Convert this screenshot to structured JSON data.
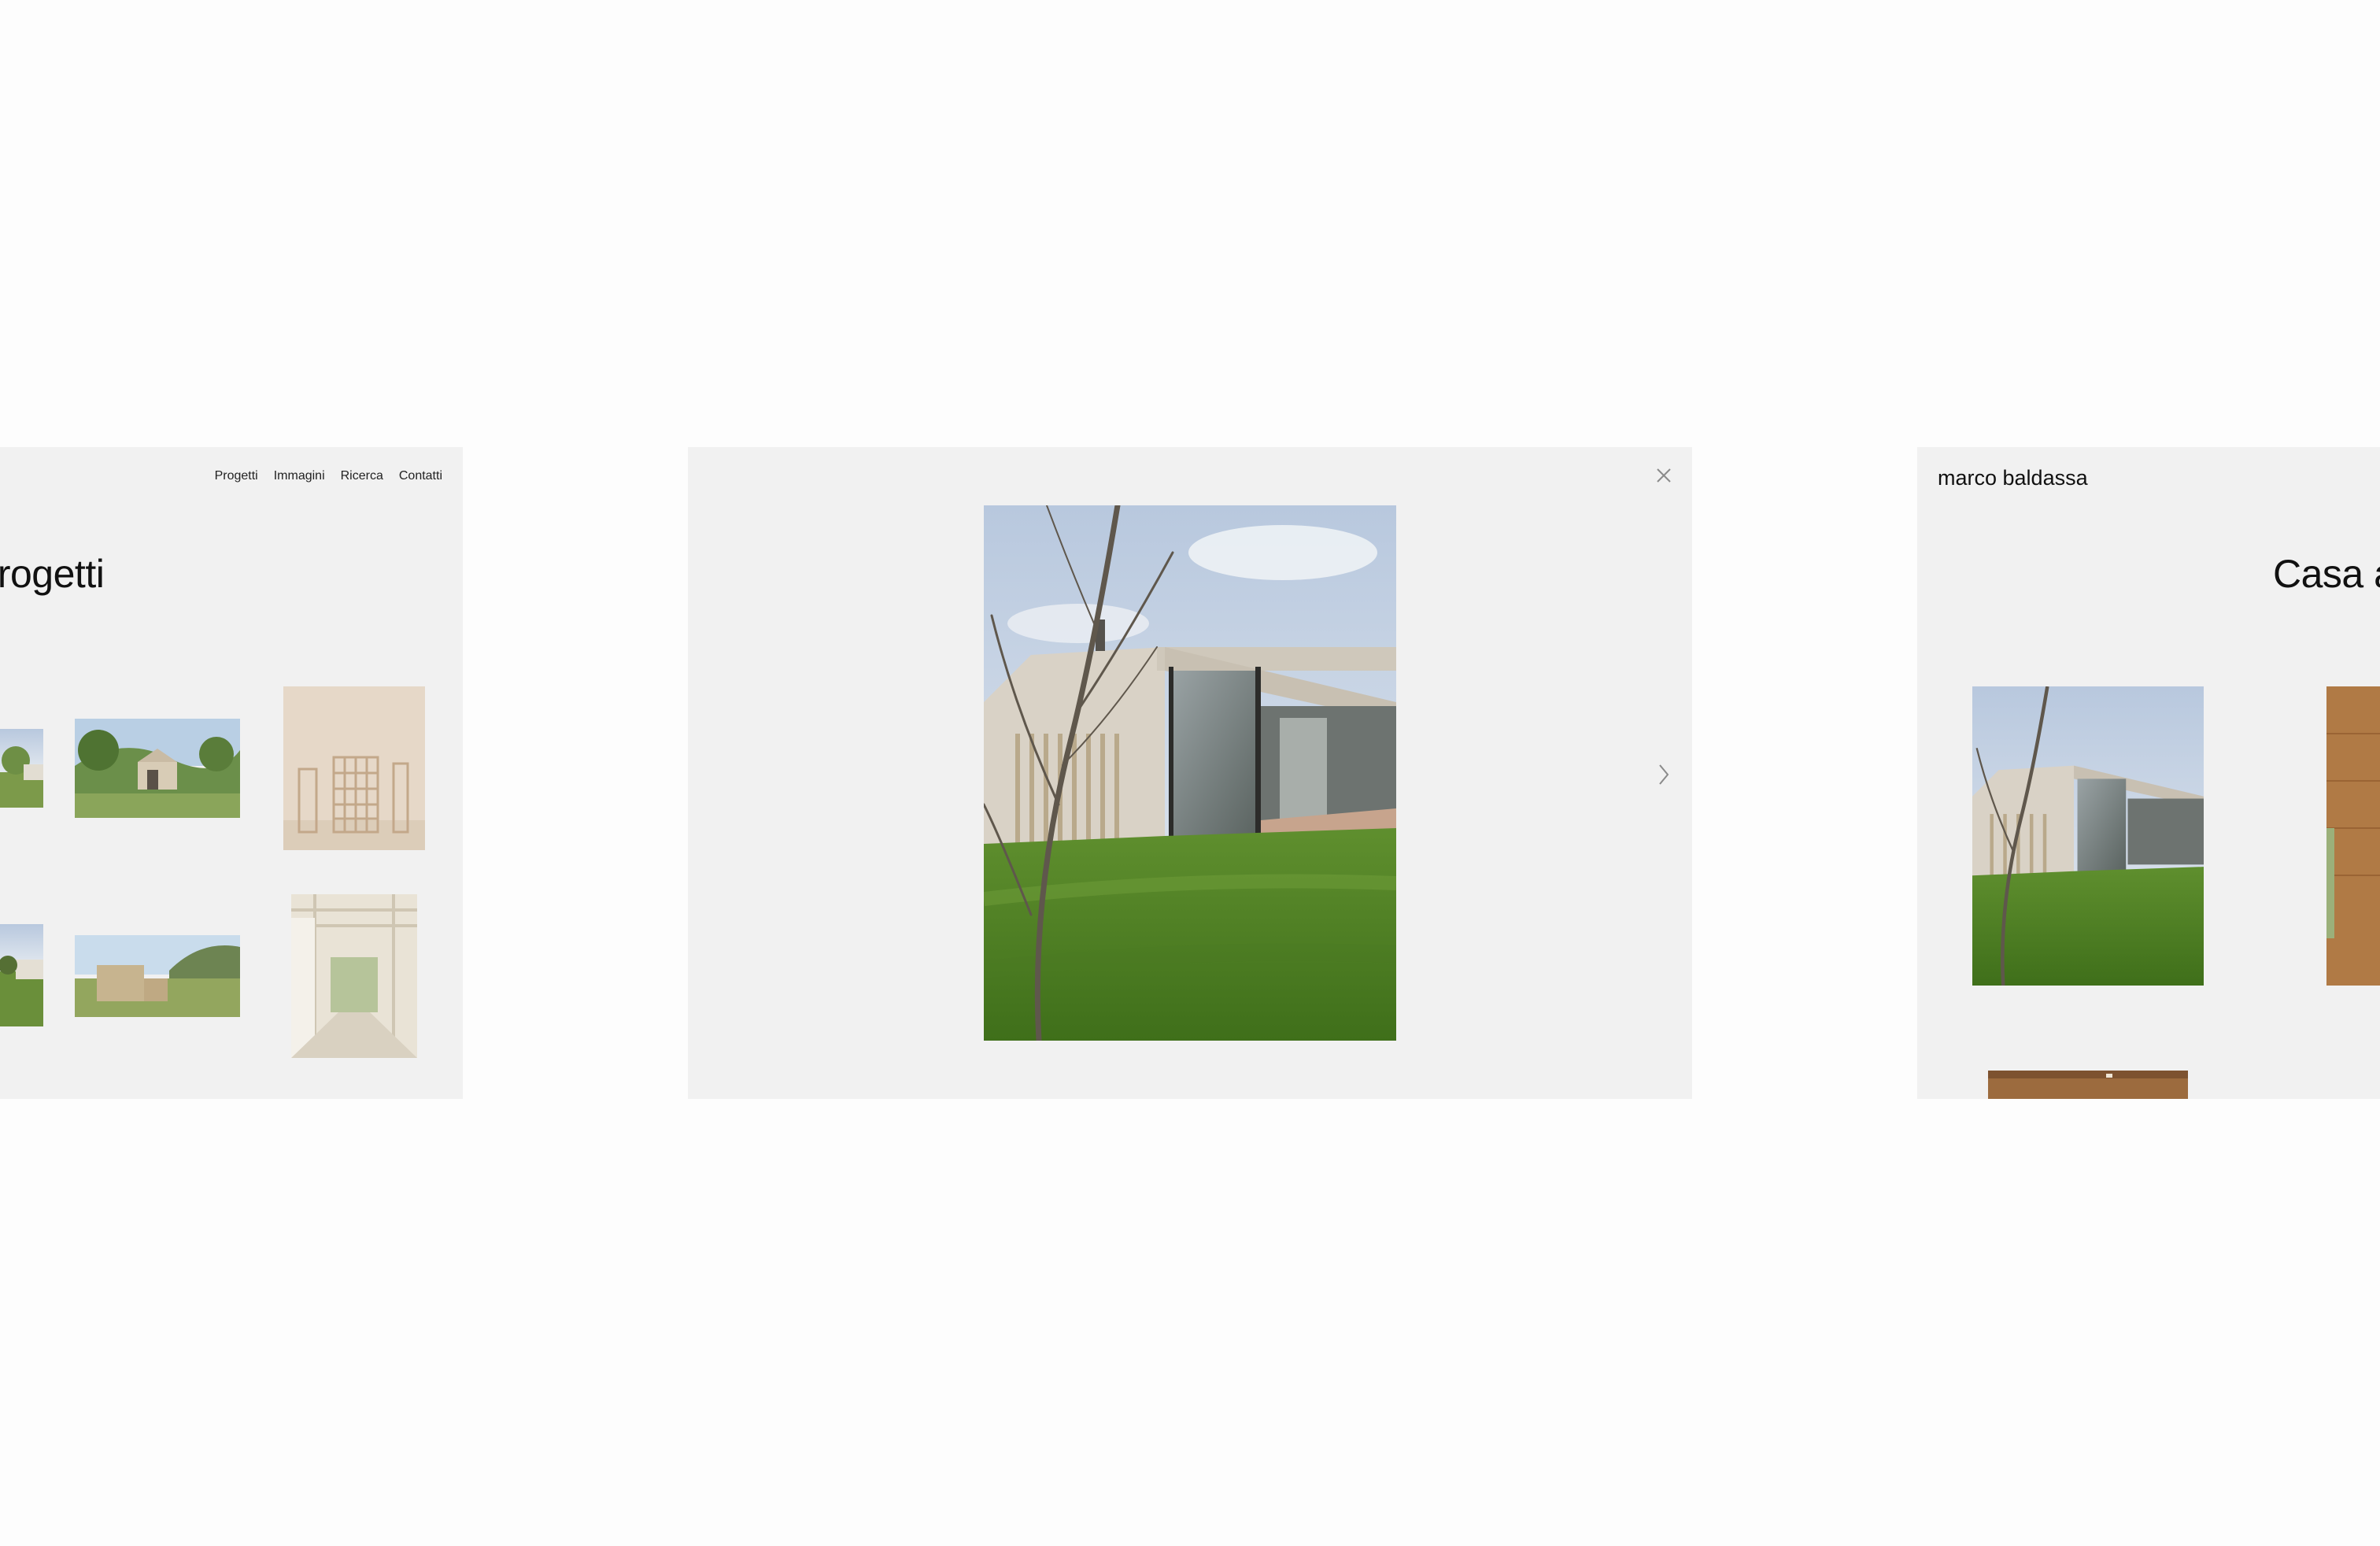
{
  "left_panel": {
    "nav": [
      "Progetti",
      "Immagini",
      "Ricerca",
      "Contatti"
    ],
    "heading": "Progetti",
    "thumbnails": [
      {
        "subject": "house-trees"
      },
      {
        "subject": "house-hillside"
      },
      {
        "subject": "wooden-shelving"
      },
      {
        "subject": "house-field"
      },
      {
        "subject": "box-house-valley"
      },
      {
        "subject": "interior-corridor"
      }
    ]
  },
  "lightbox": {
    "close_icon": "close-icon",
    "next_icon": "chevron-right-icon",
    "photo_subject": "house-lawn-glazed-corner"
  },
  "right_panel": {
    "brand": "marco baldassa",
    "heading": "Casa a"
  },
  "colors": {
    "page_bg": "#fdfdfd",
    "panel_bg": "#f1f1f1",
    "text": "#111111",
    "icon": "#8a8a8a"
  }
}
